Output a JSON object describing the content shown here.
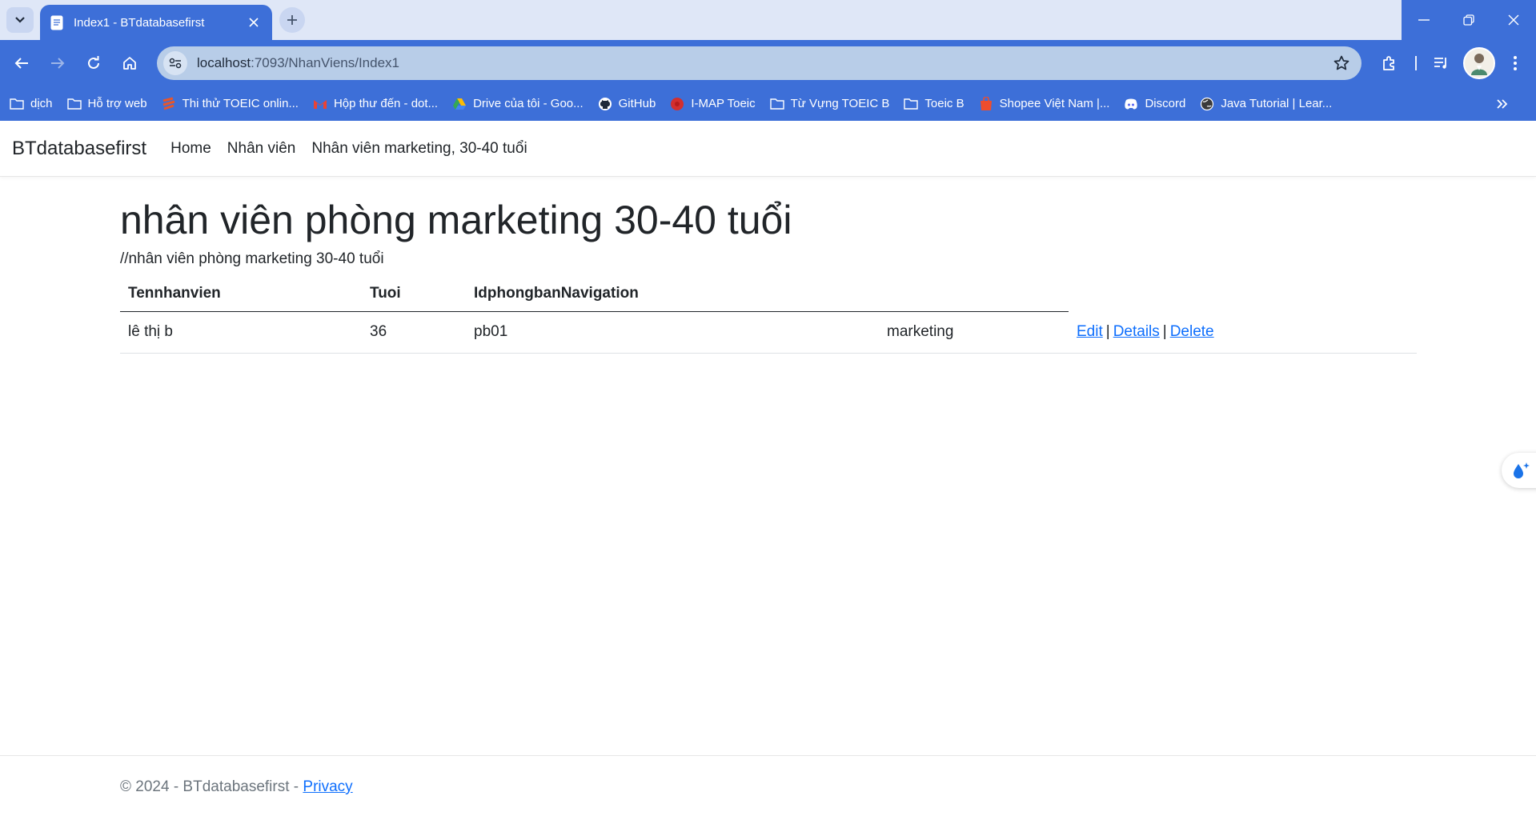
{
  "browser": {
    "tab_title": "Index1 - BTdatabasefirst",
    "url_host": "localhost",
    "url_path": ":7093/NhanViens/Index1",
    "accent": "#3d6fd8",
    "bookmarks": [
      {
        "label": "dịch",
        "icon": "folder-icon"
      },
      {
        "label": "Hỗ trợ web",
        "icon": "folder-icon"
      },
      {
        "label": "Thi thử TOEIC onlin...",
        "icon": "toeic-logo-icon"
      },
      {
        "label": "Hộp thư đến - dot...",
        "icon": "gmail-icon"
      },
      {
        "label": "Drive của tôi - Goo...",
        "icon": "drive-icon"
      },
      {
        "label": "GitHub",
        "icon": "github-icon"
      },
      {
        "label": "I-MAP Toeic",
        "icon": "imap-icon"
      },
      {
        "label": "Từ Vựng TOEIC B",
        "icon": "folder-icon"
      },
      {
        "label": "Toeic B",
        "icon": "folder-icon"
      },
      {
        "label": "Shopee Việt Nam |...",
        "icon": "shopee-icon"
      },
      {
        "label": "Discord",
        "icon": "discord-icon"
      },
      {
        "label": "Java Tutorial | Lear...",
        "icon": "globe-icon"
      }
    ]
  },
  "navbar": {
    "brand": "BTdatabasefirst",
    "links": [
      "Home",
      "Nhân viên",
      "Nhân viên marketing, 30-40 tuổi"
    ]
  },
  "main": {
    "title": "nhân viên phòng marketing 30-40 tuổi",
    "comment": "//nhân viên phòng marketing 30-40 tuổi",
    "table": {
      "headers": [
        "Tennhanvien",
        "Tuoi",
        "IdphongbanNavigation"
      ],
      "rows": [
        {
          "name": "lê thị b",
          "age": "36",
          "dept_id": "pb01",
          "dept_name": "marketing"
        }
      ],
      "actions": {
        "edit": "Edit",
        "details": "Details",
        "delete": "Delete",
        "sep": "|"
      }
    }
  },
  "footer": {
    "text": "© 2024 - BTdatabasefirst - ",
    "privacy": "Privacy"
  }
}
